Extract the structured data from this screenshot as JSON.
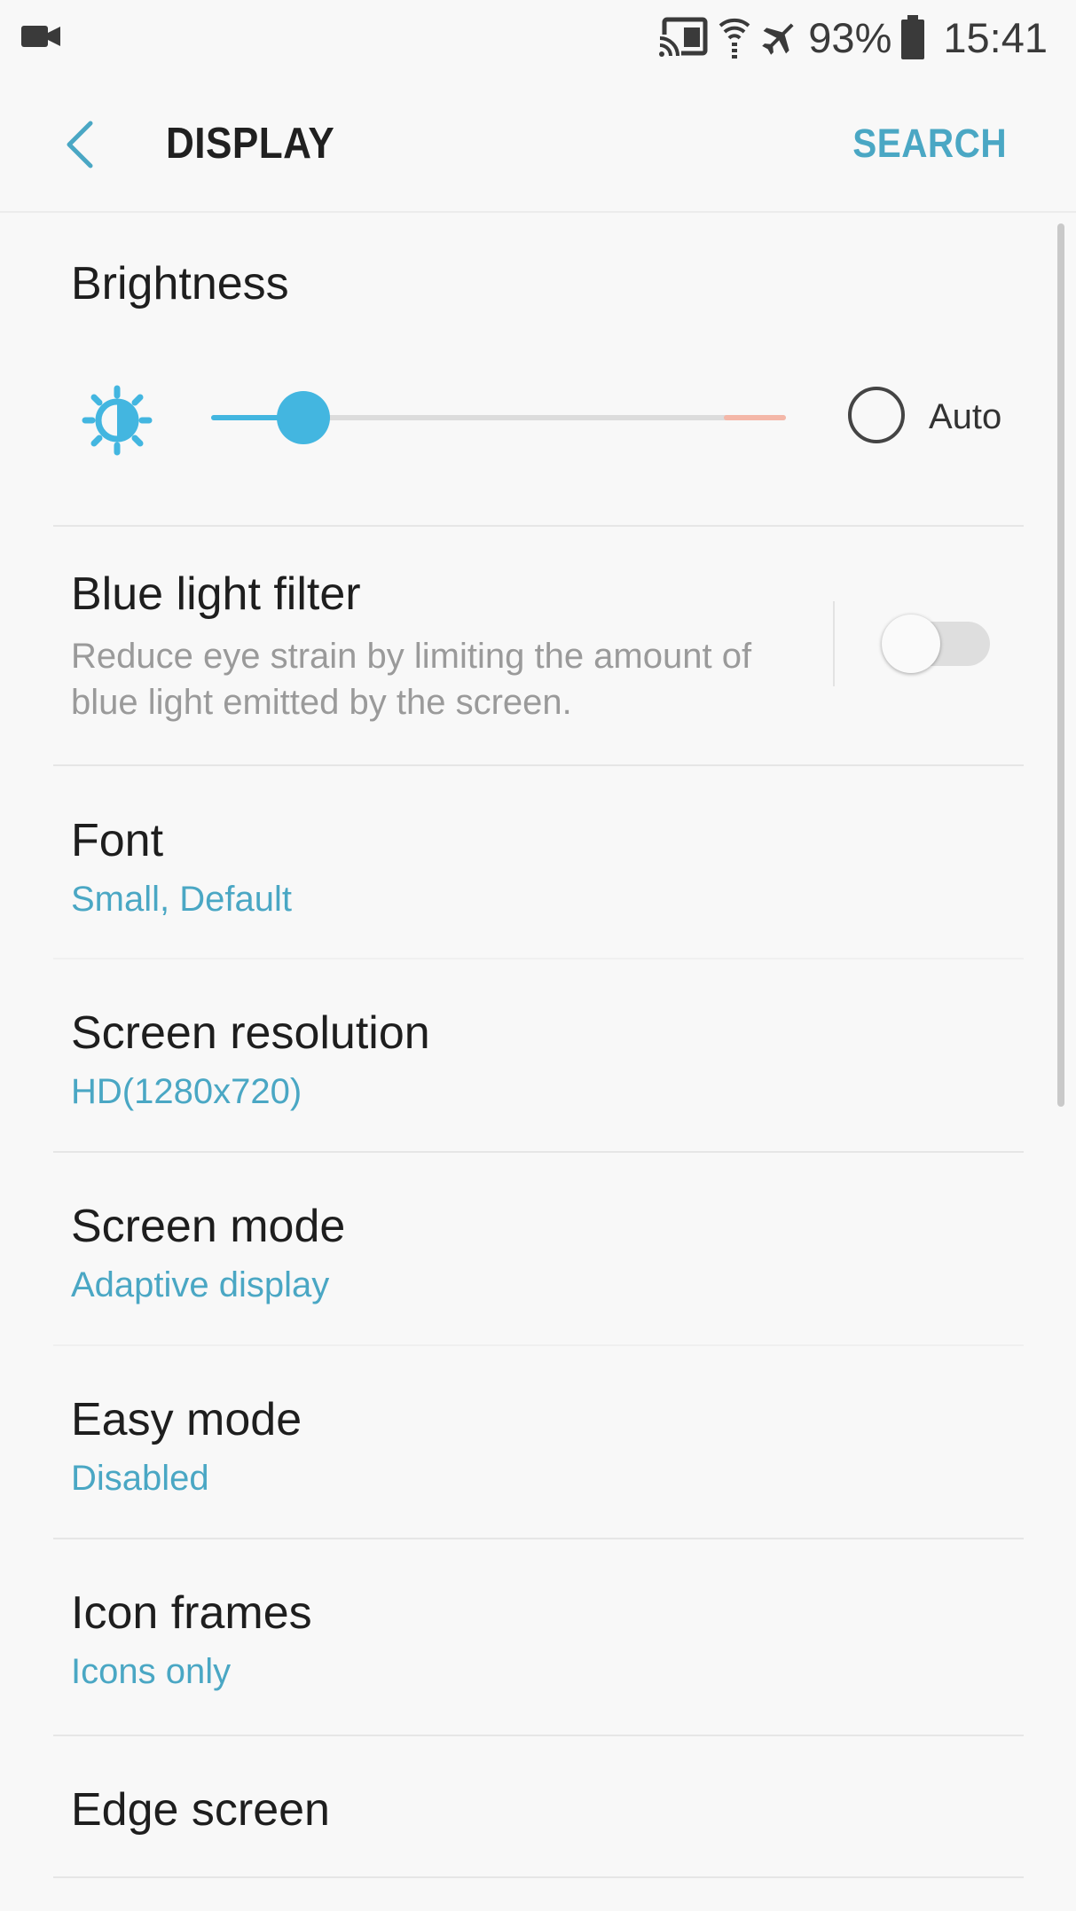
{
  "status_bar": {
    "battery_percent": "93%",
    "time": "15:41",
    "icons": [
      "video-camera-icon",
      "cast-icon",
      "wifi-calling-icon",
      "airplane-mode-icon",
      "battery-icon"
    ]
  },
  "header": {
    "title": "DISPLAY",
    "search_label": "SEARCH",
    "back_icon": "chevron-left-icon"
  },
  "brightness": {
    "title": "Brightness",
    "level_fraction": 0.16,
    "auto_label": "Auto",
    "auto_checked": false
  },
  "blue_light_filter": {
    "title": "Blue light filter",
    "description": "Reduce eye strain by limiting the amount of blue light emitted by the screen.",
    "enabled": false
  },
  "settings": [
    {
      "title": "Font",
      "value": "Small, Default"
    },
    {
      "title": "Screen resolution",
      "value": "HD(1280x720)"
    },
    {
      "title": "Screen mode",
      "value": "Adaptive display"
    },
    {
      "title": "Easy mode",
      "value": "Disabled"
    },
    {
      "title": "Icon frames",
      "value": "Icons only"
    },
    {
      "title": "Edge screen"
    }
  ],
  "colors": {
    "accent": "#4aa7c4",
    "slider": "#43b6e0",
    "background": "#f8f8f8"
  }
}
